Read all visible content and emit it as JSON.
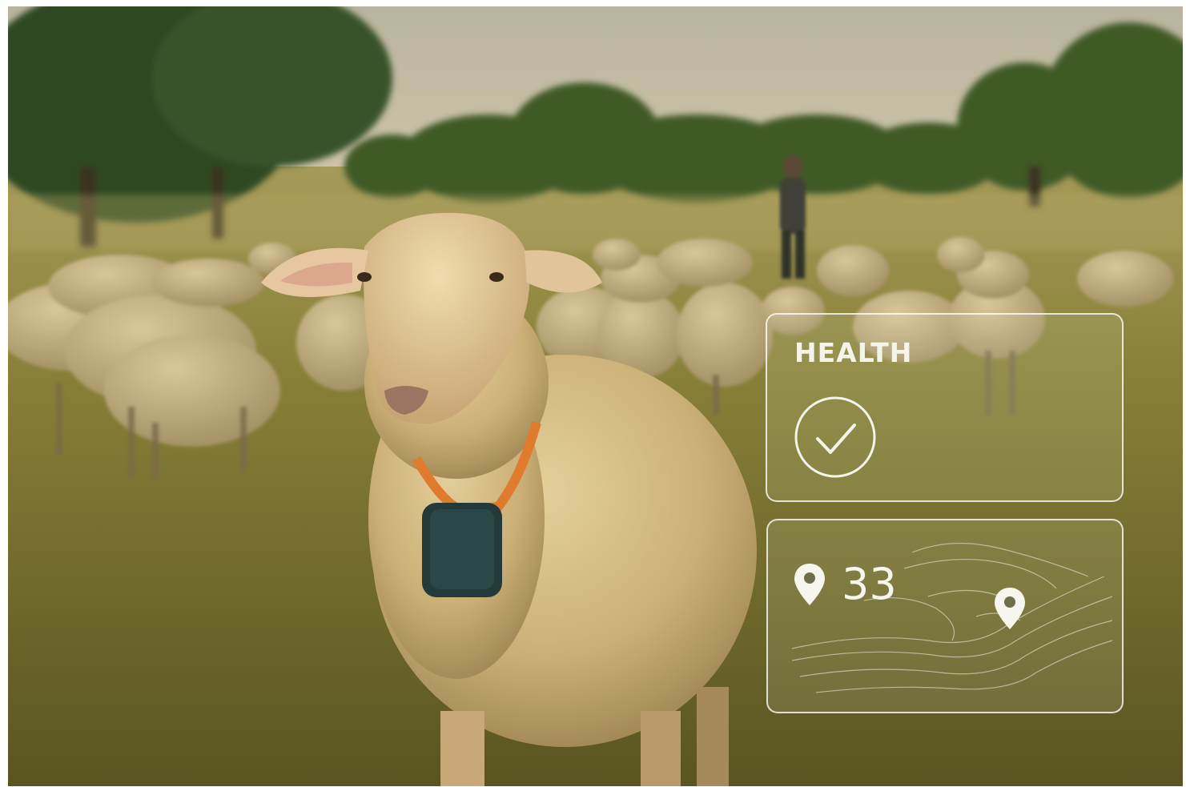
{
  "overlay": {
    "health_title": "HEALTH",
    "health_icon": "check-circle-icon",
    "location_icon": "location-pin-icon",
    "location_count": "33",
    "map_pin_icon": "location-pin-icon",
    "accent_color": "#ffffff",
    "collar_color": "#e07a2c",
    "tracker_color": "#23393a"
  }
}
